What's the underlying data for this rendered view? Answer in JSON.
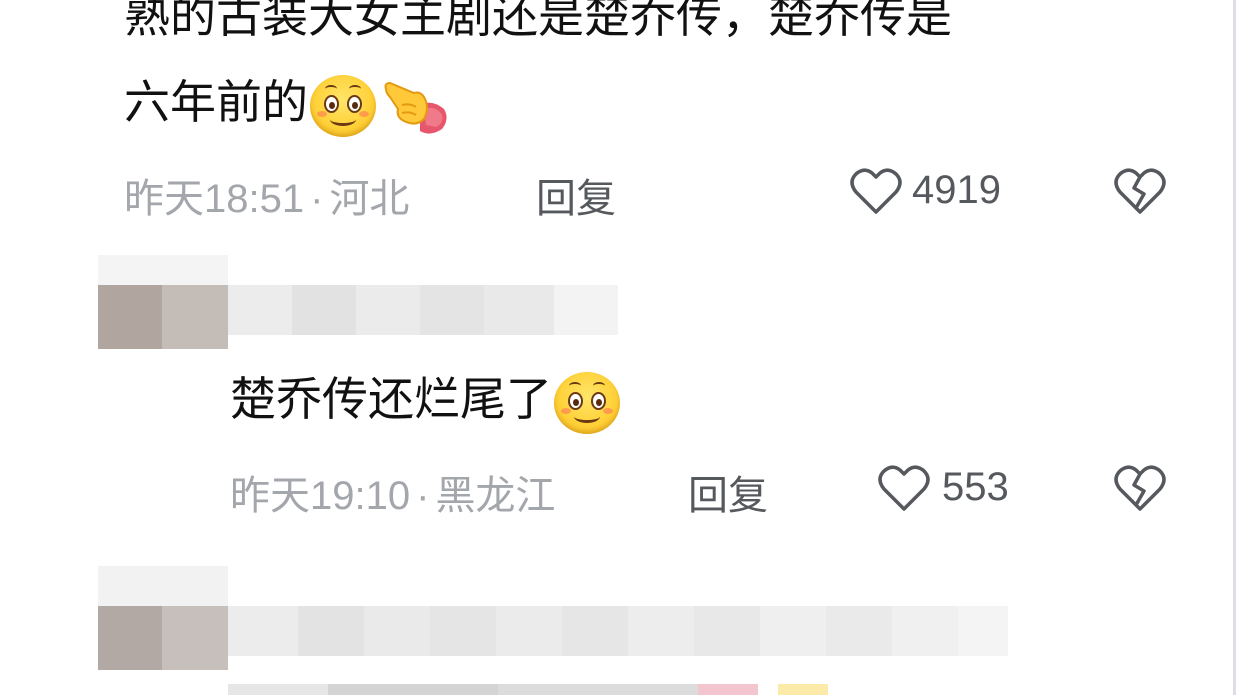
{
  "comments": [
    {
      "text_line1": "熟的古装大女主剧还是楚乔传，楚乔传是",
      "text_line2": "六年前的",
      "time": "昨天18:51",
      "location": "河北",
      "reply_label": "回复",
      "likes": "4919"
    },
    {
      "text": "楚乔传还烂尾了",
      "time": "昨天19:10",
      "location": "黑龙江",
      "reply_label": "回复",
      "likes": "553"
    }
  ],
  "separator": "·",
  "icons": {
    "like": "heart-outline-icon",
    "dislike": "broken-heart-icon",
    "emoji_smile": "smile-emoji",
    "emoji_point": "pointing-hand-emoji"
  },
  "colors": {
    "text": "#111111",
    "meta": "#a3a6ab",
    "action": "#55585c",
    "avatar_blur": "#b3aaa5"
  }
}
